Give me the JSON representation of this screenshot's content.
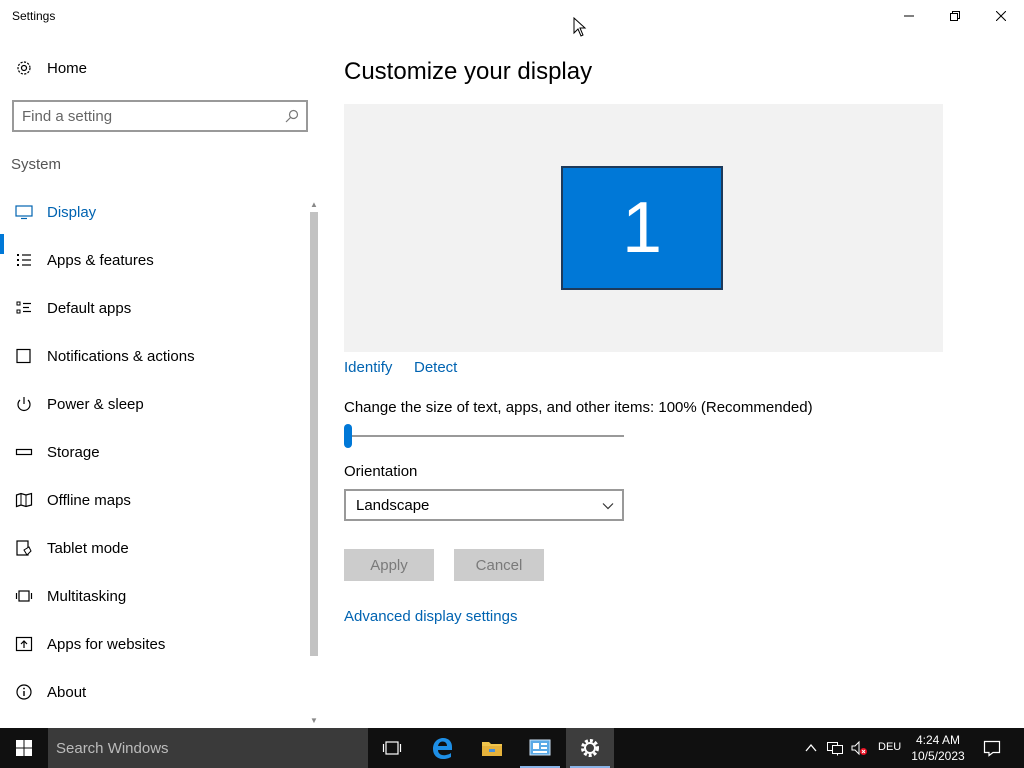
{
  "window": {
    "title": "Settings"
  },
  "sidebar": {
    "home_label": "Home",
    "search_placeholder": "Find a setting",
    "section_label": "System",
    "items": [
      {
        "label": "Display",
        "icon": "monitor-icon",
        "active": true
      },
      {
        "label": "Apps & features",
        "icon": "list-icon"
      },
      {
        "label": "Default apps",
        "icon": "default-apps-icon"
      },
      {
        "label": "Notifications & actions",
        "icon": "message-icon"
      },
      {
        "label": "Power & sleep",
        "icon": "power-icon"
      },
      {
        "label": "Storage",
        "icon": "drive-icon"
      },
      {
        "label": "Offline maps",
        "icon": "map-icon"
      },
      {
        "label": "Tablet mode",
        "icon": "tablet-icon"
      },
      {
        "label": "Multitasking",
        "icon": "multitask-icon"
      },
      {
        "label": "Apps for websites",
        "icon": "web-apps-icon"
      },
      {
        "label": "About",
        "icon": "info-icon"
      }
    ]
  },
  "main": {
    "title": "Customize your display",
    "monitor_number": "1",
    "identify_label": "Identify",
    "detect_label": "Detect",
    "scale_label": "Change the size of text, apps, and other items: 100% (Recommended)",
    "scale_fraction": 0,
    "orientation_label": "Orientation",
    "orientation_value": "Landscape",
    "apply_label": "Apply",
    "cancel_label": "Cancel",
    "advanced_link": "Advanced display settings"
  },
  "taskbar": {
    "search_text": "Search Windows",
    "language": "DEU",
    "time": "4:24 AM",
    "date": "10/5/2023"
  },
  "colors": {
    "accent": "#0078d7",
    "link": "#0063b1",
    "taskbar": "#101010"
  }
}
